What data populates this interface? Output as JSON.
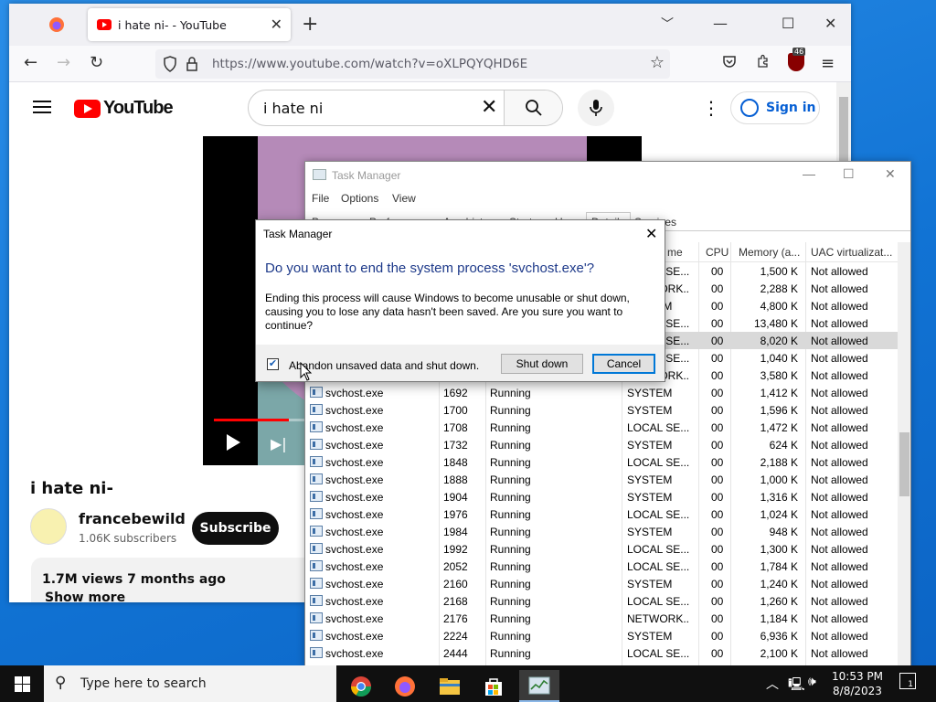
{
  "browser": {
    "tab_title": "i hate ni- - YouTube",
    "url": "https://www.youtube.com/watch?v=oXLPQYQHD6E",
    "extension_badge": "46"
  },
  "youtube": {
    "logo_text": "YouTube",
    "search_query": "i hate ni",
    "sign_in": "Sign in",
    "video_title": "i hate ni-",
    "channel_name": "francebewild",
    "subscribers": "1.06K subscribers",
    "subscribe": "Subscribe",
    "views_date": "1.7M views  7 months ago",
    "show_more": "Show more",
    "progress": 0.18
  },
  "taskmgr": {
    "title": "Task Manager",
    "menu": [
      "File",
      "Options",
      "View"
    ],
    "tabs": [
      "Processes",
      "Performance",
      "App history",
      "Startup",
      "Users",
      "Details",
      "Services"
    ],
    "active_tab": "Details",
    "columns": {
      "name": "me",
      "cpu": "CPU",
      "memory": "Memory (a...",
      "uac": "UAC virtualizat..."
    },
    "hidden_rows": [
      {
        "user": "LOCAL SE...",
        "cpu": "00",
        "mem": "1,500 K",
        "uac": "Not allowed"
      },
      {
        "user": "NETWORK...",
        "cpu": "00",
        "mem": "2,288 K",
        "uac": "Not allowed"
      },
      {
        "user": "SYSTEM",
        "cpu": "00",
        "mem": "4,800 K",
        "uac": "Not allowed"
      },
      {
        "user": "LOCAL SE...",
        "cpu": "00",
        "mem": "13,480 K",
        "uac": "Not allowed"
      },
      {
        "user": "LOCAL SE...",
        "cpu": "00",
        "mem": "8,020 K",
        "uac": "Not allowed"
      },
      {
        "user": "LOCAL SE...",
        "cpu": "00",
        "mem": "1,040 K",
        "uac": "Not allowed"
      },
      {
        "user": "NETWORK...",
        "cpu": "00",
        "mem": "3,580 K",
        "uac": "Not allowed"
      }
    ],
    "rows": [
      {
        "name": "svchost.exe",
        "pid": "1692",
        "status": "Running",
        "user": "SYSTEM",
        "cpu": "00",
        "mem": "1,412 K",
        "uac": "Not allowed"
      },
      {
        "name": "svchost.exe",
        "pid": "1700",
        "status": "Running",
        "user": "SYSTEM",
        "cpu": "00",
        "mem": "1,596 K",
        "uac": "Not allowed"
      },
      {
        "name": "svchost.exe",
        "pid": "1708",
        "status": "Running",
        "user": "LOCAL SE...",
        "cpu": "00",
        "mem": "1,472 K",
        "uac": "Not allowed"
      },
      {
        "name": "svchost.exe",
        "pid": "1732",
        "status": "Running",
        "user": "SYSTEM",
        "cpu": "00",
        "mem": "624 K",
        "uac": "Not allowed"
      },
      {
        "name": "svchost.exe",
        "pid": "1848",
        "status": "Running",
        "user": "LOCAL SE...",
        "cpu": "00",
        "mem": "2,188 K",
        "uac": "Not allowed"
      },
      {
        "name": "svchost.exe",
        "pid": "1888",
        "status": "Running",
        "user": "SYSTEM",
        "cpu": "00",
        "mem": "1,000 K",
        "uac": "Not allowed"
      },
      {
        "name": "svchost.exe",
        "pid": "1904",
        "status": "Running",
        "user": "SYSTEM",
        "cpu": "00",
        "mem": "1,316 K",
        "uac": "Not allowed"
      },
      {
        "name": "svchost.exe",
        "pid": "1976",
        "status": "Running",
        "user": "LOCAL SE...",
        "cpu": "00",
        "mem": "1,024 K",
        "uac": "Not allowed"
      },
      {
        "name": "svchost.exe",
        "pid": "1984",
        "status": "Running",
        "user": "SYSTEM",
        "cpu": "00",
        "mem": "948 K",
        "uac": "Not allowed"
      },
      {
        "name": "svchost.exe",
        "pid": "1992",
        "status": "Running",
        "user": "LOCAL SE...",
        "cpu": "00",
        "mem": "1,300 K",
        "uac": "Not allowed"
      },
      {
        "name": "svchost.exe",
        "pid": "2052",
        "status": "Running",
        "user": "LOCAL SE...",
        "cpu": "00",
        "mem": "1,784 K",
        "uac": "Not allowed"
      },
      {
        "name": "svchost.exe",
        "pid": "2160",
        "status": "Running",
        "user": "SYSTEM",
        "cpu": "00",
        "mem": "1,240 K",
        "uac": "Not allowed"
      },
      {
        "name": "svchost.exe",
        "pid": "2168",
        "status": "Running",
        "user": "LOCAL SE...",
        "cpu": "00",
        "mem": "1,260 K",
        "uac": "Not allowed"
      },
      {
        "name": "svchost.exe",
        "pid": "2176",
        "status": "Running",
        "user": "NETWORK...",
        "cpu": "00",
        "mem": "1,184 K",
        "uac": "Not allowed"
      },
      {
        "name": "svchost.exe",
        "pid": "2224",
        "status": "Running",
        "user": "SYSTEM",
        "cpu": "00",
        "mem": "6,936 K",
        "uac": "Not allowed"
      },
      {
        "name": "svchost.exe",
        "pid": "2444",
        "status": "Running",
        "user": "LOCAL SE...",
        "cpu": "00",
        "mem": "2,100 K",
        "uac": "Not allowed"
      }
    ]
  },
  "dialog": {
    "title": "Task Manager",
    "heading": "Do you want to end the system process 'svchost.exe'?",
    "body": "Ending this process will cause Windows to become unusable or shut down, causing you to lose any data hasn't been saved. Are you sure you want to continue?",
    "checkbox_label": "Abandon unsaved data and shut down.",
    "checkbox_checked": true,
    "shutdown": "Shut down",
    "cancel": "Cancel"
  },
  "taskbar": {
    "search_placeholder": "Type here to search",
    "time": "10:53 PM",
    "date": "8/8/2023",
    "notifications": "1"
  },
  "colors": {
    "desktop": "#1173d4",
    "youtube_red": "#ff0000",
    "link_blue": "#065fd4",
    "dialog_heading": "#1e3a8a"
  }
}
